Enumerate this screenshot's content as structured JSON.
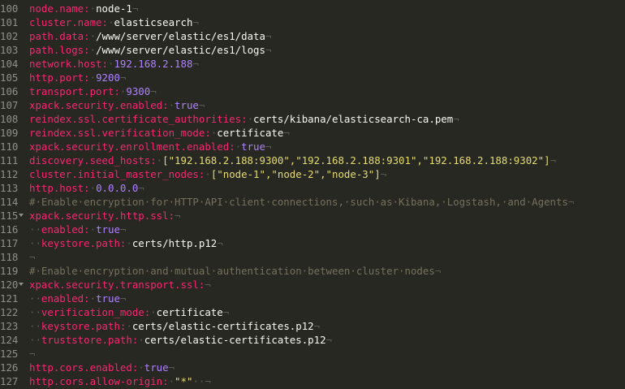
{
  "editor": {
    "lines": [
      {
        "num": "100",
        "indent": "",
        "key": "node.name:",
        "sp": "·",
        "value": "node-1",
        "vclass": "v",
        "eol": "¬"
      },
      {
        "num": "101",
        "indent": "",
        "key": "cluster.name:",
        "sp": "·",
        "value": "elasticsearch",
        "vclass": "v",
        "eol": "¬"
      },
      {
        "num": "102",
        "indent": "",
        "key": "path.data:",
        "sp": "·",
        "value": "/www/server/elastic/es1/data",
        "vclass": "v",
        "eol": "¬"
      },
      {
        "num": "103",
        "indent": "",
        "key": "path.logs:",
        "sp": "·",
        "value": "/www/server/elastic/es1/logs",
        "vclass": "v",
        "eol": "¬"
      },
      {
        "num": "104",
        "indent": "",
        "key": "network.host:",
        "sp": "·",
        "value": "192.168.2.188",
        "vclass": "n",
        "eol": "¬"
      },
      {
        "num": "105",
        "indent": "",
        "key": "http.port:",
        "sp": "·",
        "value": "9200",
        "vclass": "n",
        "eol": "¬"
      },
      {
        "num": "106",
        "indent": "",
        "key": "transport.port:",
        "sp": "·",
        "value": "9300",
        "vclass": "n",
        "eol": "¬"
      },
      {
        "num": "107",
        "indent": "",
        "key": "xpack.security.enabled:",
        "sp": "·",
        "value": "true",
        "vclass": "n",
        "eol": "¬"
      },
      {
        "num": "108",
        "indent": "",
        "key": "reindex.ssl.certificate_authorities:",
        "sp": "·",
        "value": "certs/kibana/elasticsearch-ca.pem",
        "vclass": "v",
        "eol": "¬"
      },
      {
        "num": "109",
        "indent": "",
        "key": "reindex.ssl.verification_mode:",
        "sp": "·",
        "value": "certificate",
        "vclass": "v",
        "eol": "¬"
      },
      {
        "num": "110",
        "indent": "",
        "key": "xpack.security.enrollment.enabled:",
        "sp": "·",
        "value": "true",
        "vclass": "n",
        "eol": "¬"
      },
      {
        "num": "111",
        "indent": "",
        "key": "discovery.seed_hosts:",
        "sp": "·",
        "value": "[\"192.168.2.188:9300\",\"192.168.2.188:9301\",\"192.168.2.188:9302\"]",
        "vclass": "s",
        "eol": "¬"
      },
      {
        "num": "112",
        "indent": "",
        "key": "cluster.initial_master_nodes:",
        "sp": "·",
        "value": "[\"node-1\",\"node-2\",\"node-3\"]",
        "vclass": "s",
        "eol": "¬"
      },
      {
        "num": "113",
        "indent": "",
        "key": "http.host:",
        "sp": "·",
        "value": "0.0.0.0",
        "vclass": "n",
        "eol": "¬"
      },
      {
        "num": "114",
        "indent": "",
        "comment": "#·Enable·encryption·for·HTTP·API·client·connections,·such·as·Kibana,·Logstash,·and·Agents",
        "eol": "¬"
      },
      {
        "num": "115",
        "fold": true,
        "indent": "",
        "key": "xpack.security.http.ssl:",
        "sp": "",
        "value": "",
        "vclass": "v",
        "eol": "¬"
      },
      {
        "num": "116",
        "indent": "··",
        "key": "enabled:",
        "sp": "·",
        "value": "true",
        "vclass": "n",
        "eol": "¬"
      },
      {
        "num": "117",
        "indent": "··",
        "key": "keystore.path:",
        "sp": "·",
        "value": "certs/http.p12",
        "vclass": "v",
        "eol": "¬"
      },
      {
        "num": "118",
        "indent": "",
        "blank": true,
        "eol": "¬"
      },
      {
        "num": "119",
        "indent": "",
        "comment": "#·Enable·encryption·and·mutual·authentication·between·cluster·nodes",
        "eol": "¬"
      },
      {
        "num": "120",
        "fold": true,
        "indent": "",
        "key": "xpack.security.transport.ssl:",
        "sp": "",
        "value": "",
        "vclass": "v",
        "eol": "¬"
      },
      {
        "num": "121",
        "indent": "··",
        "key": "enabled:",
        "sp": "·",
        "value": "true",
        "vclass": "n",
        "eol": "¬"
      },
      {
        "num": "122",
        "indent": "··",
        "key": "verification_mode:",
        "sp": "·",
        "value": "certificate",
        "vclass": "v",
        "eol": "¬"
      },
      {
        "num": "123",
        "indent": "··",
        "key": "keystore.path:",
        "sp": "·",
        "value": "certs/elastic-certificates.p12",
        "vclass": "v",
        "eol": "¬"
      },
      {
        "num": "124",
        "indent": "··",
        "key": "truststore.path:",
        "sp": "·",
        "value": "certs/elastic-certificates.p12",
        "vclass": "v",
        "eol": "¬"
      },
      {
        "num": "125",
        "indent": "",
        "blank": true,
        "eol": "¬"
      },
      {
        "num": "126",
        "indent": "",
        "key": "http.cors.enabled:",
        "sp": "·",
        "value": "true",
        "vclass": "n",
        "eol": "¬"
      },
      {
        "num": "127",
        "indent": "",
        "key": "http.cors.allow-origin:",
        "sp": "·",
        "value": "\"*\"",
        "vclass": "s",
        "eol": "··¬"
      }
    ]
  }
}
